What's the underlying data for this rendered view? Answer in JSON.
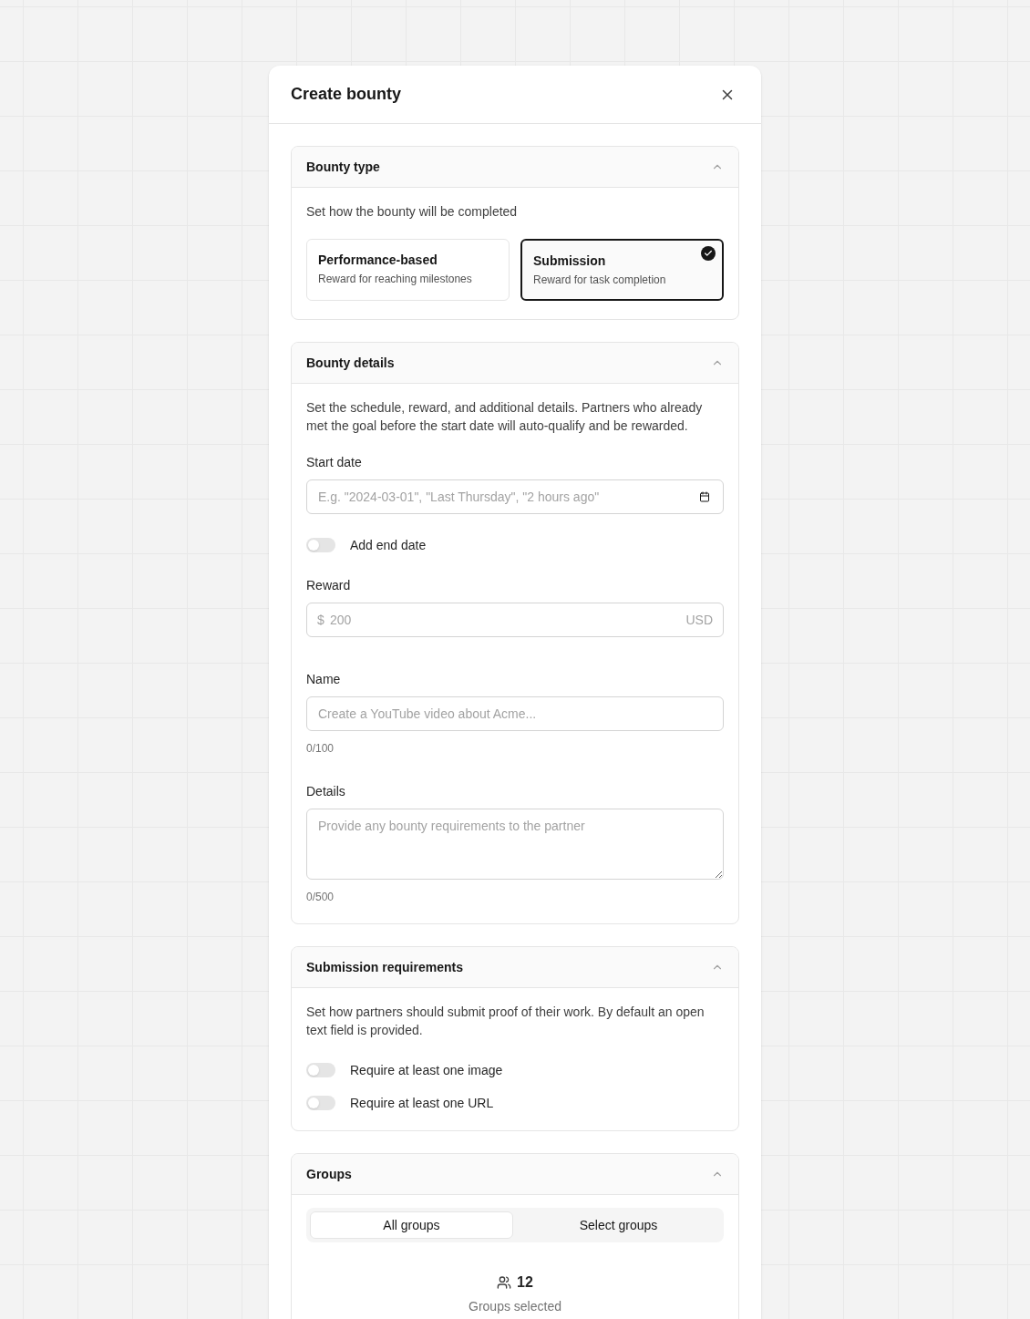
{
  "dialog": {
    "title": "Create bounty"
  },
  "bounty_type": {
    "title": "Bounty type",
    "expanded": true,
    "description": "Set how the bounty will be completed",
    "options": [
      {
        "title": "Performance-based",
        "subtitle": "Reward for reaching milestones",
        "selected": false
      },
      {
        "title": "Submission",
        "subtitle": "Reward for task completion",
        "selected": true
      }
    ]
  },
  "bounty_details": {
    "title": "Bounty details",
    "expanded": true,
    "description": "Set the schedule, reward, and additional details. Partners who already met the goal before the start date will auto-qualify and be rewarded.",
    "start_date": {
      "label": "Start date",
      "placeholder": "E.g. \"2024-03-01\", \"Last Thursday\", \"2 hours ago\""
    },
    "end_date_toggle": {
      "label": "Add end date",
      "on": false
    },
    "reward": {
      "label": "Reward",
      "prefix": "$",
      "placeholder": "200",
      "suffix": "USD"
    },
    "name": {
      "label": "Name",
      "placeholder": "Create a YouTube video about Acme...",
      "counter": "0/100"
    },
    "details": {
      "label": "Details",
      "placeholder": "Provide any bounty requirements to the partner",
      "counter": "0/500"
    }
  },
  "submission_requirements": {
    "title": "Submission requirements",
    "expanded": true,
    "description": "Set how partners should submit proof of their work. By default an open text field is provided.",
    "toggles": [
      {
        "label": "Require at least one image",
        "on": false
      },
      {
        "label": "Require at least one URL",
        "on": false
      }
    ]
  },
  "groups": {
    "title": "Groups",
    "expanded": true,
    "tabs": [
      {
        "label": "All groups",
        "selected": true
      },
      {
        "label": "Select groups",
        "selected": false
      }
    ],
    "count": "12",
    "caption": "Groups selected"
  }
}
